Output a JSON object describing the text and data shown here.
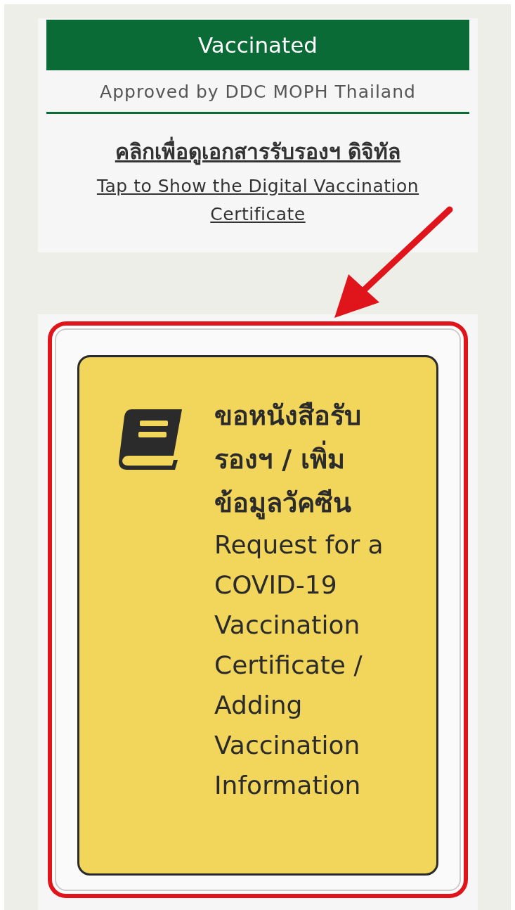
{
  "status_banner": {
    "label": "Vaccinated"
  },
  "approval_note": "Approved by DDC MOPH Thailand",
  "certificate_link": {
    "thai": "คลิกเพื่อดูเอกสารรับรองฯ ดิจิทัล",
    "english": "Tap to Show the Digital Vaccination Certificate"
  },
  "request_button": {
    "thai": "ขอหนังสือรับรองฯ / เพิ่มข้อมูลวัคซีน",
    "english": "Request for a COVID-19 Vaccination Certificate / Adding Vaccination Information"
  }
}
